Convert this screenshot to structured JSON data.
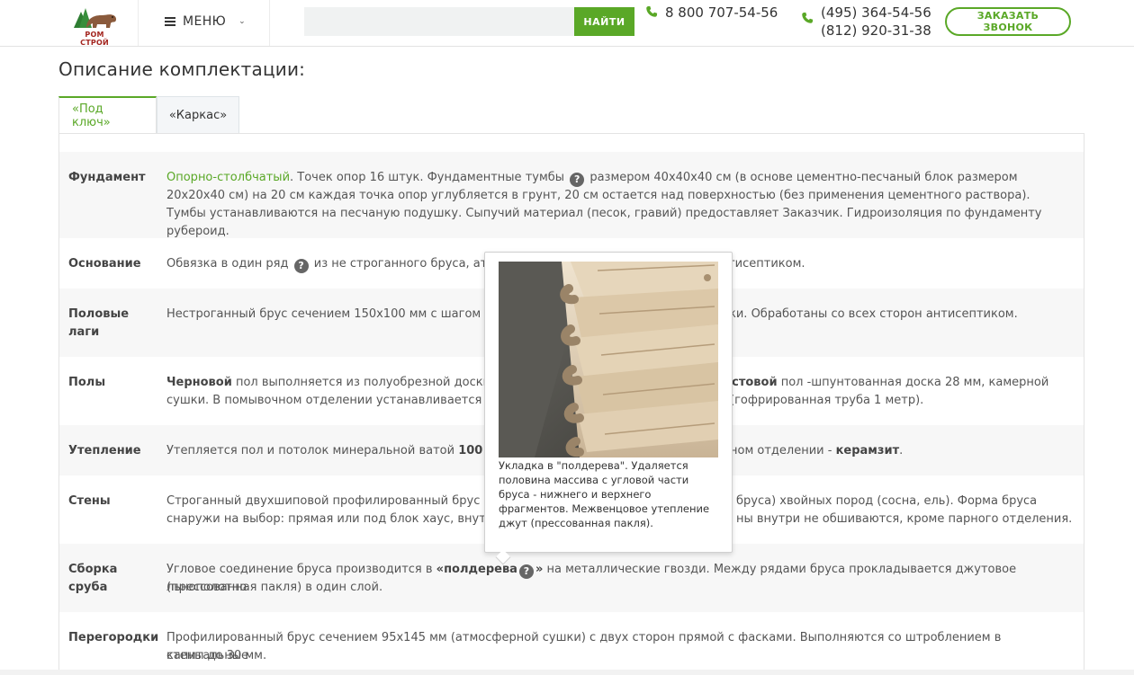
{
  "header": {
    "logo_text": "РОМ СТРОЙ",
    "menu_label": "МЕНЮ",
    "search_placeholder": "",
    "search_button": "НАЙТИ",
    "phone_main": "8 800 707-54-56",
    "phone_moscow": "(495) 364-54-56",
    "phone_spb": "(812) 920-31-38",
    "call_button": "ЗАКАЗАТЬ ЗВОНОК"
  },
  "page": {
    "section_title": "Описание комплектации:"
  },
  "tabs": [
    {
      "label": "«Под ключ»",
      "active": true
    },
    {
      "label": "«Каркас»",
      "active": false
    }
  ],
  "spec": {
    "fundament": {
      "label": "Фундамент",
      "link": "Опорно-столбчатый",
      "t1": ". Точек опор 16 штук. Фундаментные тумбы ",
      "t2": " размером 40х40х40 см (в основе цементно-песчаный блок размером 20х20х40 см) на 20 см каждая точка опор углубляется в грунт, 20 см остается над поверхностью (без применения цементного раствора). Тумбы устанавливаются на песчаную подушку. Сыпучий материал (песок, гравий) предоставляет Заказчик. Гидроизоляция по фундаменту рубероид."
    },
    "osnovanie": {
      "label": "Основание",
      "t1": "Обвязка в один ряд ",
      "t2": " из не строганного бруса, атмос",
      "t3": "н антисептиком."
    },
    "lagi": {
      "label1": "Половые",
      "label2": "лаги",
      "t1": "Нестроганный брус сечением 150х100 мм с шагом укл",
      "t2": "ки. Обработаны со всех сторон антисептиком."
    },
    "poly": {
      "label": "Полы",
      "b1": "Черновой",
      "t1": " пол выполняется из полуобрезной доски се",
      "b2": "истовой",
      "t2": " пол -шпунтованная доска 28 мм, камерной",
      "t3": "сушки. В помывочном отделении устанавливается по",
      "t4": "(гофрированная труба 1 метр)."
    },
    "uteplenie": {
      "label": "Утепление",
      "t1": "Утепляется пол и потолок минеральной ватой ",
      "b1": "100 мм",
      "t2": "ном отделении - ",
      "b2": "керамзит",
      "t3": "."
    },
    "steny": {
      "label": "Стены",
      "t1": "Строганный двухшиповой профилированный брус ат",
      "t2": "бруса) хвойных пород (сосна, ель). Форма бруса",
      "t3": "снаружи  на выбор: прямая или под блок хаус, внутри",
      "t4": "ны внутри не обшиваются, кроме парного отделения."
    },
    "sborka": {
      "label1": "Сборка",
      "label2": "сруба",
      "t1": "Угловое соединение бруса производится в ",
      "b1": "«полдерева",
      "b2": "»",
      "t2": " на металлические гвозди. Между рядами бруса прокладывается джутовое льнополотно",
      "t3": "(прессованная пакля) в один слой."
    },
    "peregorodki": {
      "label": "Перегородки",
      "t1": "Профилированный брус сечением 95х145 мм (атмосферной сушки) с двух сторон прямой с фасками. Выполняются со штроблением в капитальные",
      "t2": "стены до 30 мм."
    }
  },
  "tooltip": {
    "text": "Укладка в \"полдерева\". Удаляется половина массива с угловой части бруса - нижнего и верхнего фрагментов. Межвенцовое утепление джут (прессованная пакля)."
  },
  "icons": {
    "help": "?"
  },
  "colors": {
    "accent": "#5aa827",
    "logo_red": "#a3241e"
  }
}
